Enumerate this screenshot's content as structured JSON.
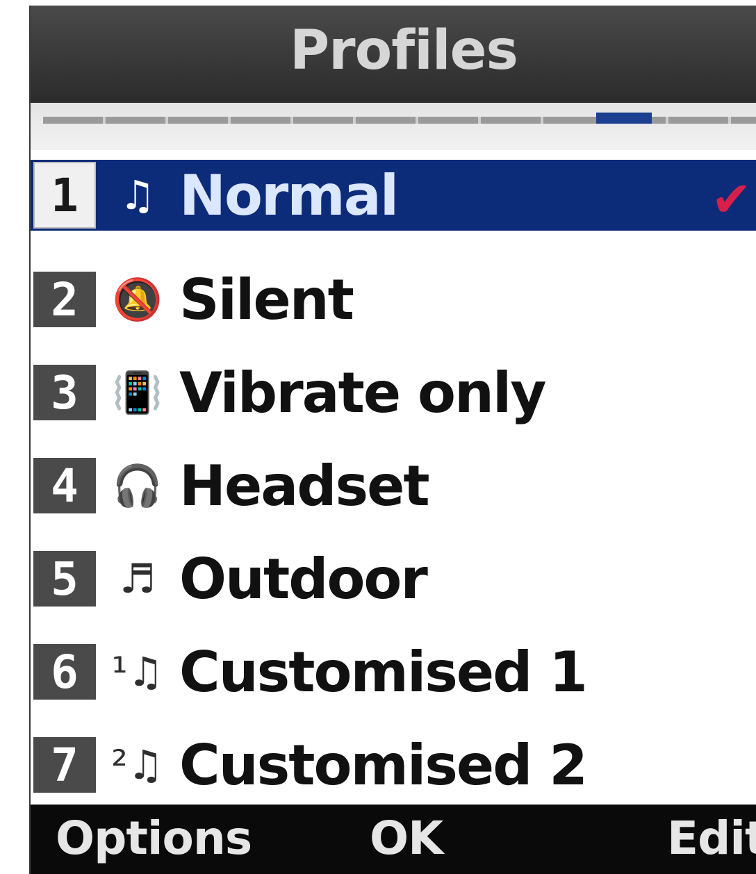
{
  "header": {
    "title": "Profiles"
  },
  "tabs": {
    "count": 12,
    "active_index": 9
  },
  "profiles": [
    {
      "number": "1",
      "icon": "music-note-icon",
      "glyph": "♫",
      "label": "Normal",
      "selected": true,
      "active_mark": "✔"
    },
    {
      "number": "2",
      "icon": "muted-bell-icon",
      "glyph": "🔕",
      "label": "Silent"
    },
    {
      "number": "3",
      "icon": "vibrate-phone-icon",
      "glyph": "📳",
      "label": "Vibrate only"
    },
    {
      "number": "4",
      "icon": "headset-icon",
      "glyph": "🎧",
      "label": "Headset"
    },
    {
      "number": "5",
      "icon": "loud-music-icon",
      "glyph": "♬",
      "label": "Outdoor"
    },
    {
      "number": "6",
      "icon": "custom-1-music-icon",
      "glyph": "¹♫",
      "label": "Customised 1"
    },
    {
      "number": "7",
      "icon": "custom-2-music-icon",
      "glyph": "²♫",
      "label": "Customised 2"
    }
  ],
  "softkeys": {
    "left": "Options",
    "center": "OK",
    "right": "Edit"
  },
  "colors": {
    "selection": "#0c2c7a",
    "check": "#d6204a",
    "title_bar": "#3a3a3a",
    "softkey_bar": "#0a0a0a"
  }
}
